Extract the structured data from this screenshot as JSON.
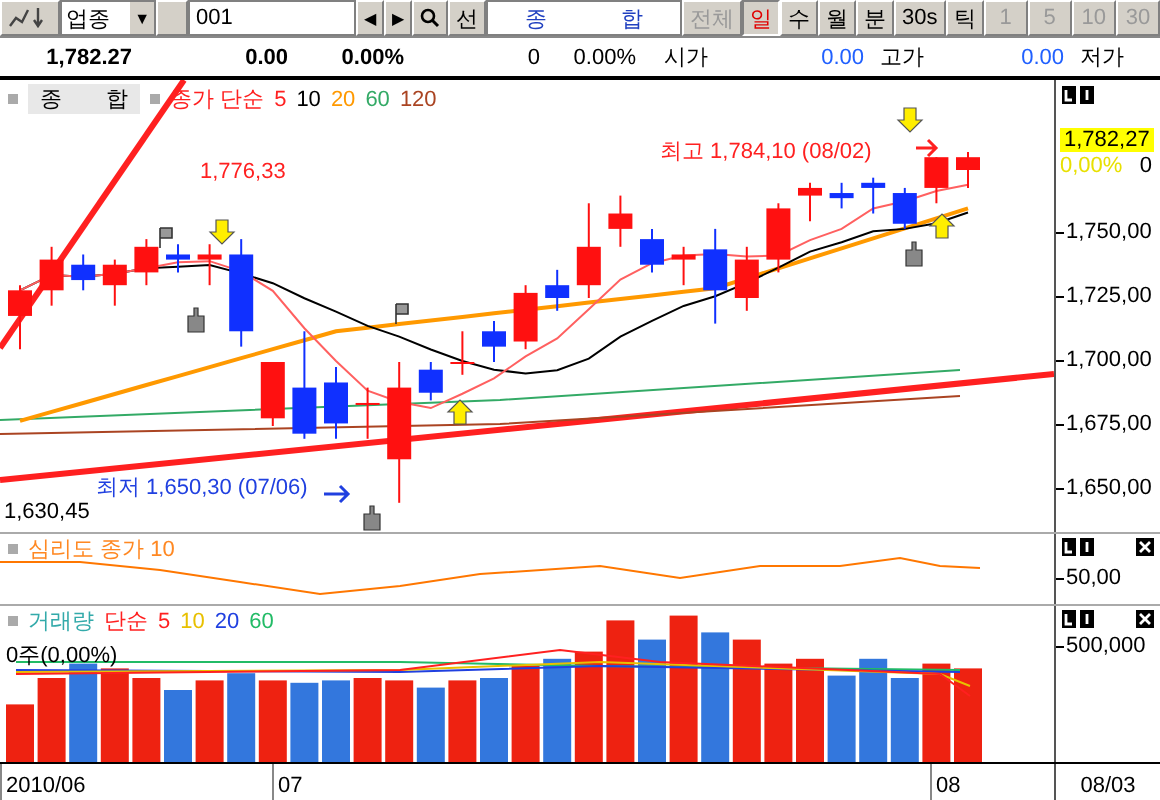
{
  "toolbar": {
    "market_dropdown": "업종",
    "dropdown_arrow": "▼",
    "code_input": "001",
    "prev_button": "◀",
    "next_button": "▶",
    "line_button": "선",
    "index_name": {
      "first": "종",
      "second": "합"
    },
    "periods": [
      {
        "label": "전체",
        "selected": false,
        "disabled": true
      },
      {
        "label": "일",
        "selected": true,
        "disabled": false
      },
      {
        "label": "수",
        "selected": false,
        "disabled": false
      },
      {
        "label": "월",
        "selected": false,
        "disabled": false
      },
      {
        "label": "분",
        "selected": false,
        "disabled": false
      },
      {
        "label": "30s",
        "selected": false,
        "disabled": false
      },
      {
        "label": "틱",
        "selected": false,
        "disabled": false
      }
    ],
    "intervals": [
      {
        "label": "1",
        "disabled": true
      },
      {
        "label": "5",
        "disabled": true
      },
      {
        "label": "10",
        "disabled": true
      },
      {
        "label": "30",
        "disabled": true
      }
    ]
  },
  "quote": {
    "price": "1,782.27",
    "change": "0.00",
    "change_rate": "0.00%",
    "volume": "0",
    "volume_rate": "0.00%",
    "open_label": "시가",
    "open": "0.00",
    "high_label": "고가",
    "high": "0.00",
    "low_label": "저가"
  },
  "price_chart": {
    "name_first": "종",
    "name_second": "합",
    "indicator": "종가 단순",
    "ma_periods": [
      {
        "label": "5",
        "color": "#ff2020"
      },
      {
        "label": "10",
        "color": "#000000"
      },
      {
        "label": "20",
        "color": "#ff9900"
      },
      {
        "label": "60",
        "color": "#33aa66"
      },
      {
        "label": "120",
        "color": "#aa4422"
      }
    ],
    "annotations": [
      {
        "text": "1,776,33",
        "color": "#ff2020"
      },
      {
        "text": "최고 1,784,10 (08/02)",
        "color": "#ff2020"
      },
      {
        "text": "최저 1,650,30 (07/06)",
        "color": "#2040e0"
      },
      {
        "text": "1,630,45",
        "color": "#000000"
      }
    ],
    "current_price": "1,782,27",
    "current_rate": "0,00%",
    "current_change": "0",
    "axis_labels": [
      "1,750,00",
      "1,725,00",
      "1,700,00",
      "1,675,00",
      "1,650,00"
    ]
  },
  "psychology_panel": {
    "title": "심리도 종가 10",
    "axis_label": "50,00"
  },
  "volume_panel": {
    "title": "거래량",
    "indicator": "단순",
    "ma_periods": [
      {
        "label": "5",
        "color": "#ff2020"
      },
      {
        "label": "10",
        "color": "#e8c000"
      },
      {
        "label": "20",
        "color": "#2040e0"
      },
      {
        "label": "60",
        "color": "#22bb66"
      }
    ],
    "summary": "0주(0,00%)",
    "axis_label": "500,000"
  },
  "date_axis": {
    "labels": [
      "2010/06",
      "07",
      "08"
    ],
    "cursor_date": "08/03"
  }
}
